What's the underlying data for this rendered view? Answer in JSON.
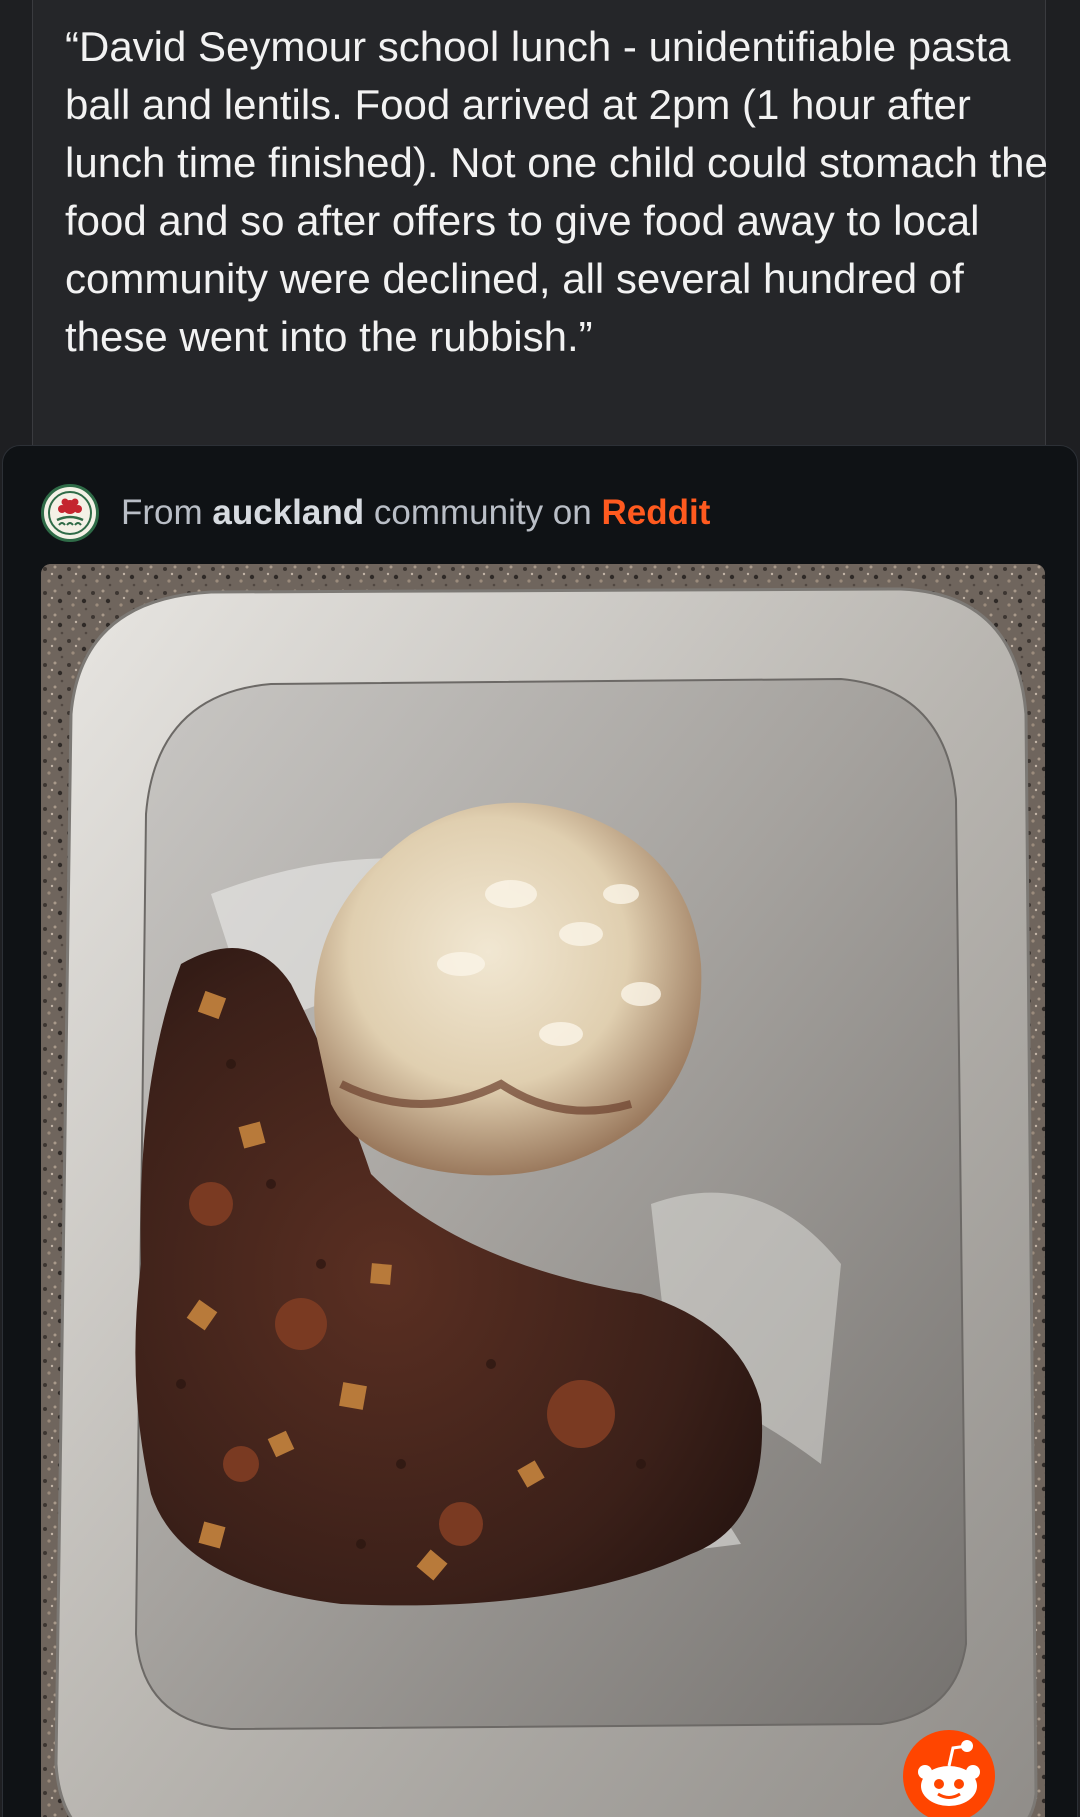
{
  "post": {
    "quote": "“David Seymour school lunch - unidentifiable pasta ball and lentils. Food arrived at 2pm (1 hour after lunch time finished). Not one child could stomach the food and so after offers to give food away to local community were declined, all several hundred of these went into the rubbish.”"
  },
  "embed": {
    "from_label": "From",
    "community_name": "auckland",
    "community_word": "community on",
    "platform": "Reddit",
    "community_icon": "auckland-community-avatar",
    "badge_icon": "reddit-snoo-icon",
    "platform_color": "#ff5a1f",
    "photo_subject": "foil-tray-pasta-ball-and-lentils"
  }
}
